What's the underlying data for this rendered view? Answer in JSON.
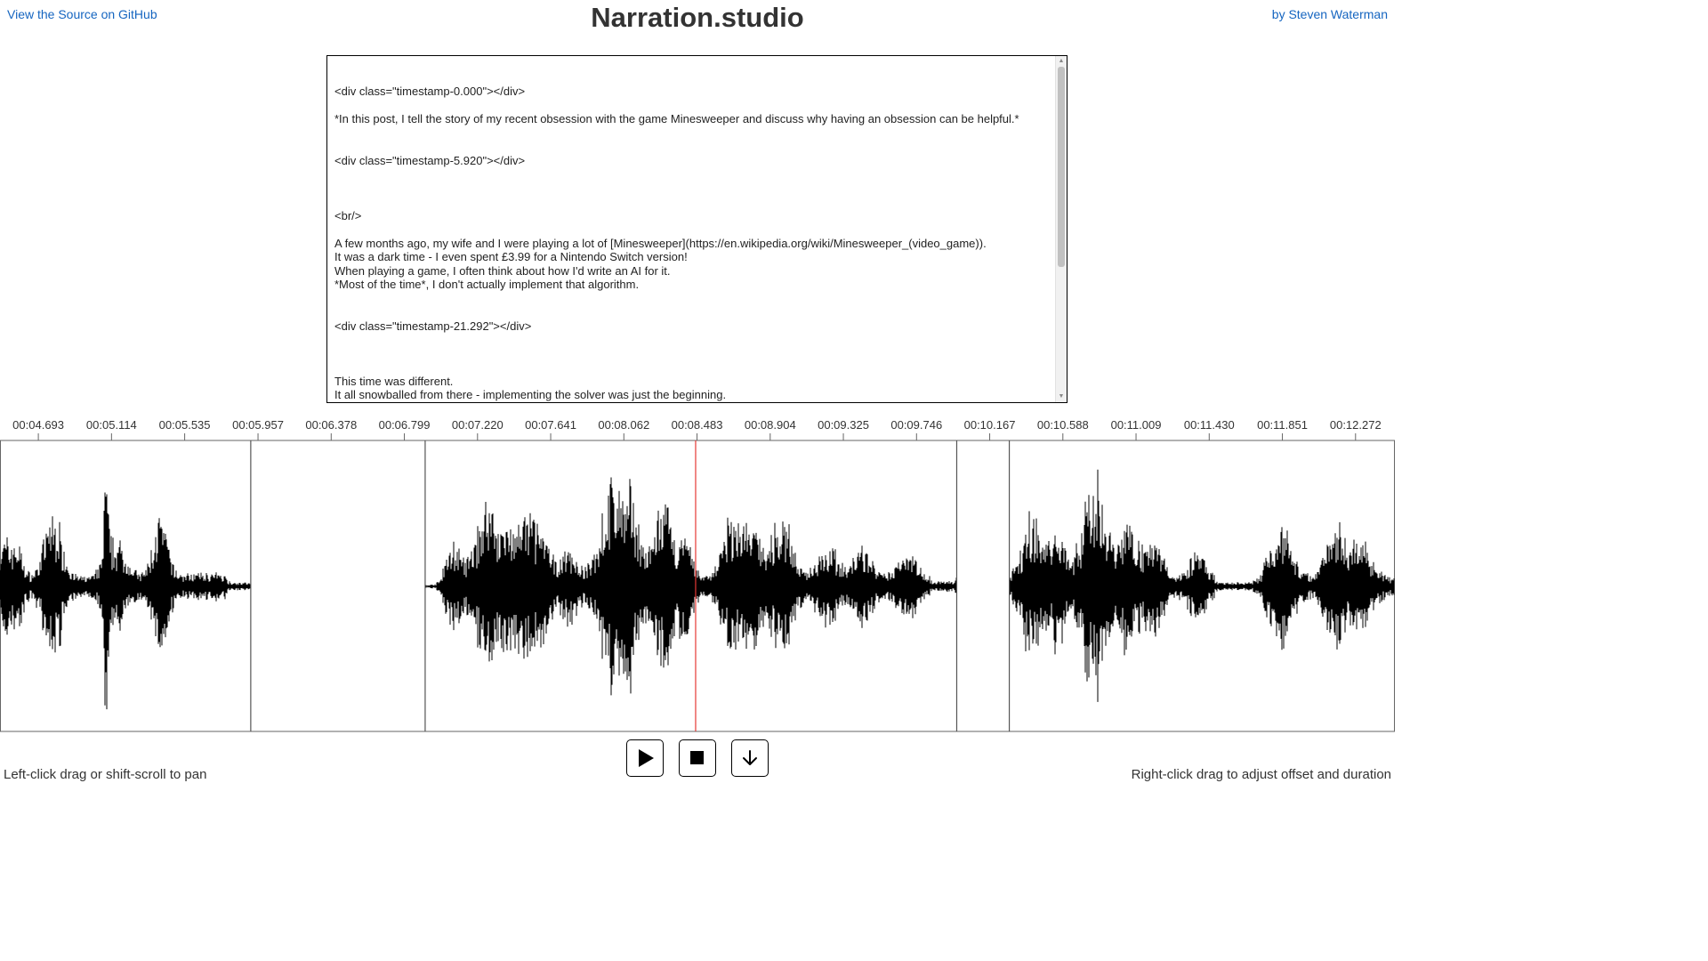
{
  "header": {
    "title": "Narration.studio",
    "github_link": "View the Source on GitHub",
    "author_link": "by Steven Waterman"
  },
  "editor": {
    "lines": [
      "<div class=\"timestamp-0.000\"></div>",
      "",
      "*In this post, I tell the story of my recent obsession with the game Minesweeper and discuss why having an obsession can be helpful.*",
      "",
      "",
      "<div class=\"timestamp-5.920\"></div>",
      "",
      "",
      "",
      "<br/>",
      "",
      "A few months ago, my wife and I were playing a lot of [Minesweeper](https://en.wikipedia.org/wiki/Minesweeper_(video_game)).",
      "It was a dark time - I even spent £3.99 for a Nintendo Switch version!",
      "When playing a game, I often think about how I'd write an AI for it.",
      "*Most of the time*, I don't actually implement that algorithm.",
      "",
      "",
      "<div class=\"timestamp-21.292\"></div>",
      "",
      "",
      "",
      "This time was different.",
      "It all snowballed from there - implementing the solver was just the beginning."
    ]
  },
  "timeline": {
    "tick_labels": [
      "00:04.693",
      "00:05.114",
      "00:05.535",
      "00:05.957",
      "00:06.378",
      "00:06.799",
      "00:07.220",
      "00:07.641",
      "00:08.062",
      "00:08.483",
      "00:08.904",
      "00:09.325",
      "00:09.746",
      "00:10.167",
      "00:10.588",
      "00:11.009",
      "00:11.430",
      "00:11.851",
      "00:12.272"
    ],
    "view_start_sec": 4.4724,
    "view_end_sec": 12.4983,
    "playhead_sec": 8.475,
    "segment_boundaries_sec": [
      5.9152,
      6.9187,
      9.9773,
      10.2798
    ],
    "silent_ranges_sec": [
      [
        5.9152,
        6.9187
      ],
      [
        9.9773,
        10.2798
      ]
    ],
    "playhead_color": "#e53935",
    "waveform_color": "#000000"
  },
  "controls": {
    "play_label": "Play",
    "stop_label": "Stop",
    "download_label": "Download"
  },
  "hints": {
    "left": "Left-click drag or shift-scroll to pan",
    "right": "Right-click drag to adjust offset and duration"
  }
}
